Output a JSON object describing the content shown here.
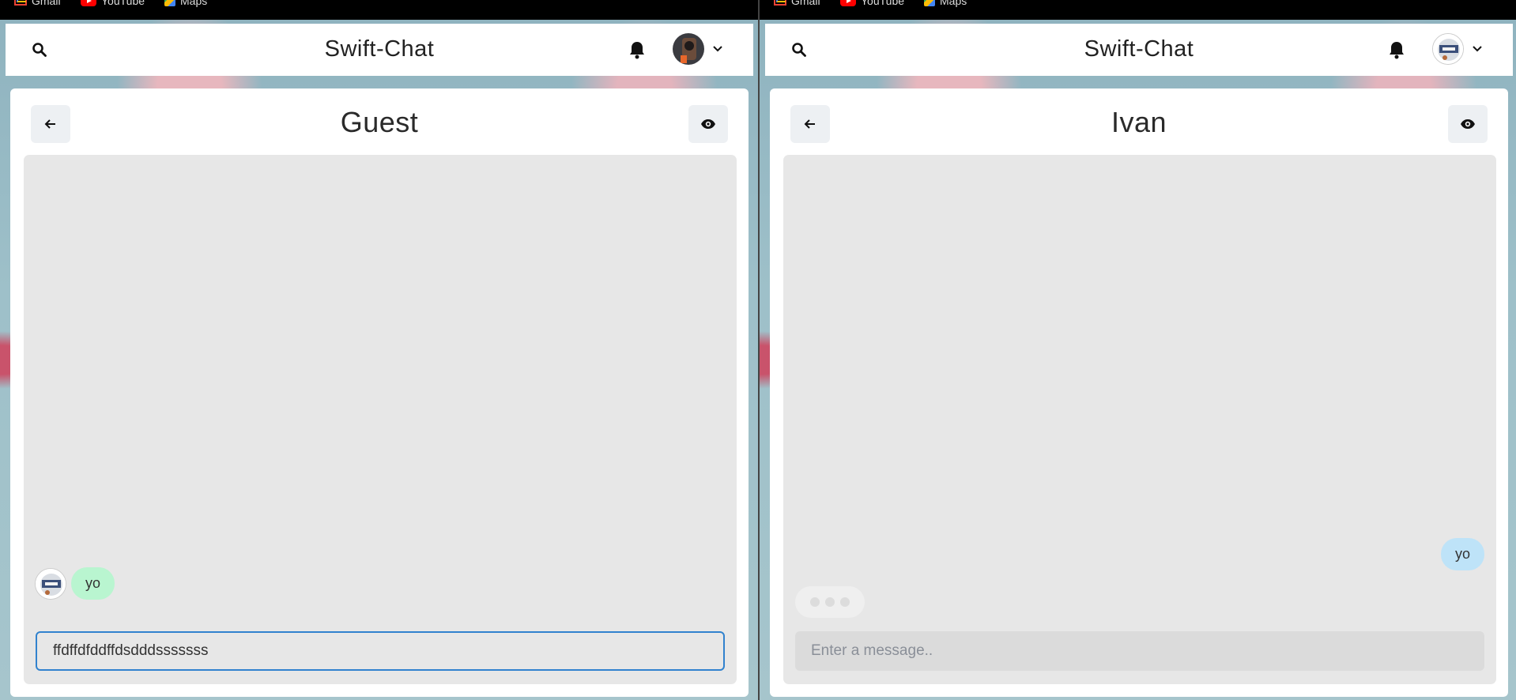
{
  "bookmarks": [
    {
      "label": "Gmail",
      "icon": "gmail-icon"
    },
    {
      "label": "YouTube",
      "icon": "youtube-icon"
    },
    {
      "label": "Maps",
      "icon": "maps-icon"
    }
  ],
  "colors": {
    "bubble_green": "#b9f5d0",
    "bubble_blue": "#bee3f8",
    "input_focus": "#3182ce",
    "chat_bg": "#e7e7e7"
  },
  "windows": [
    {
      "app_title": "Swift-Chat",
      "chat_title": "Guest",
      "messages": [
        {
          "sender": "other",
          "text": "yo",
          "bubble": "green",
          "show_avatar": true
        }
      ],
      "typing_indicator": false,
      "input": {
        "value": "ffdffdfddffdsdddsssssss",
        "placeholder": "Enter a message..",
        "focused": true
      }
    },
    {
      "app_title": "Swift-Chat",
      "chat_title": "Ivan",
      "messages": [
        {
          "sender": "self",
          "text": "yo",
          "bubble": "blue",
          "show_avatar": false
        }
      ],
      "typing_indicator": true,
      "input": {
        "value": "",
        "placeholder": "Enter a message..",
        "focused": false
      }
    }
  ]
}
